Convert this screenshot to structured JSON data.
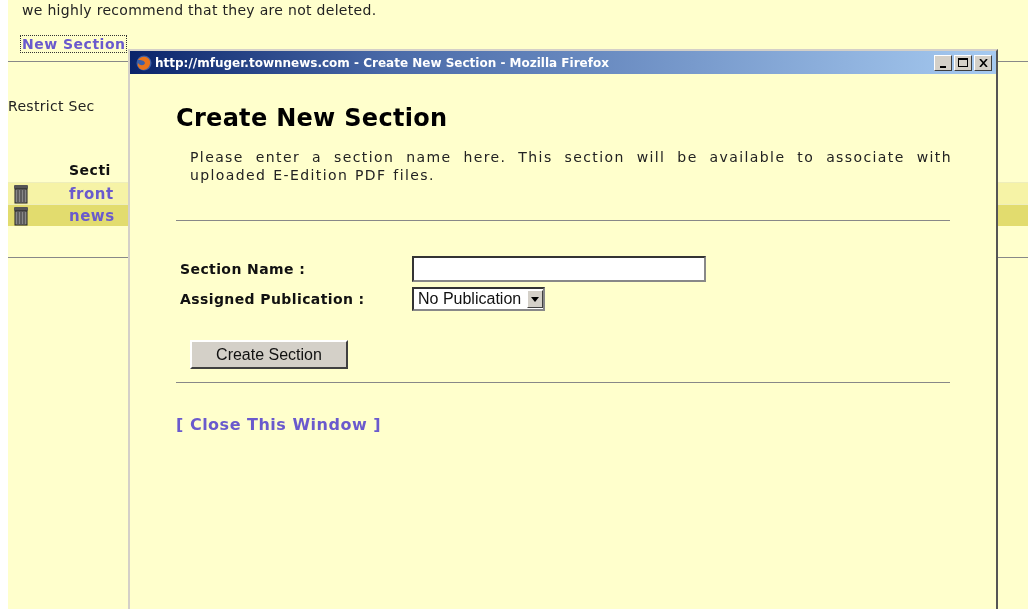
{
  "page": {
    "notice": "we highly recommend that they are not deleted.",
    "new_section_link": {
      "label": "New Section",
      "focused": true
    },
    "restrict_label": "Restrict Sec",
    "table": {
      "columns": [
        "Secti"
      ],
      "rows": [
        {
          "name": "front"
        },
        {
          "name": "news"
        }
      ]
    }
  },
  "popup": {
    "title": "http://mfuger.townnews.com - Create New Section - Mozilla Firefox",
    "heading": "Create New Section",
    "intro": "Please enter a section name here. This section will be available to associate with uploaded E-Edition PDF files.",
    "fields": [
      {
        "kind": "text",
        "label": "Section Name :"
      },
      {
        "kind": "select",
        "label": "Assigned Publication :",
        "value": "No Publication"
      }
    ],
    "submit": "Create Section",
    "close_link": "[ Close This Window ]"
  }
}
